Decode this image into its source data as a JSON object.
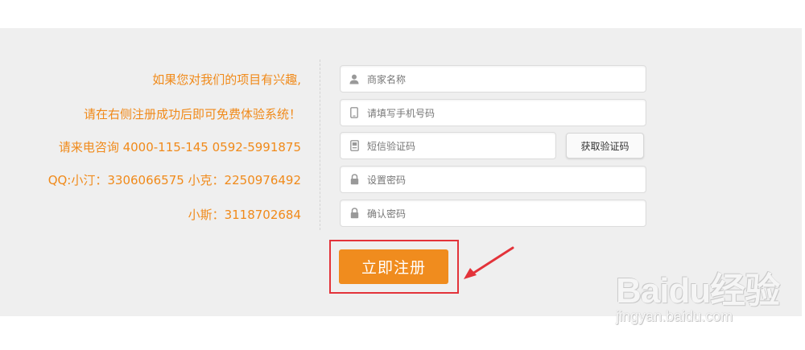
{
  "info": {
    "line1": "如果您对我们的项目有兴趣,",
    "line2": "请在右侧注册成功后即可免费体验系统！",
    "line3": "请来电咨询 4000-115-145 0592-5991875",
    "line4": "QQ:小汀：3306066575 小克：2250976492",
    "line5": "小斯：3118702684"
  },
  "form": {
    "merchant_name_placeholder": "商家名称",
    "phone_placeholder": "请填写手机号码",
    "sms_code_placeholder": "短信验证码",
    "get_code_label": "获取验证码",
    "password_placeholder": "设置密码",
    "confirm_password_placeholder": "确认密码",
    "register_label": "立即注册"
  },
  "watermark": {
    "logo_text": "Baidu经验",
    "url": "jingyan.baidu.com"
  },
  "colors": {
    "accent": "#f08c1e",
    "info_text": "#f08a1a",
    "highlight_box": "#e3333a",
    "band_background": "#efefef"
  },
  "icons": {
    "merchant_name": "user-icon",
    "phone": "phone-icon",
    "sms_code": "sms-icon",
    "password": "lock-icon",
    "confirm_password": "lock-icon"
  }
}
